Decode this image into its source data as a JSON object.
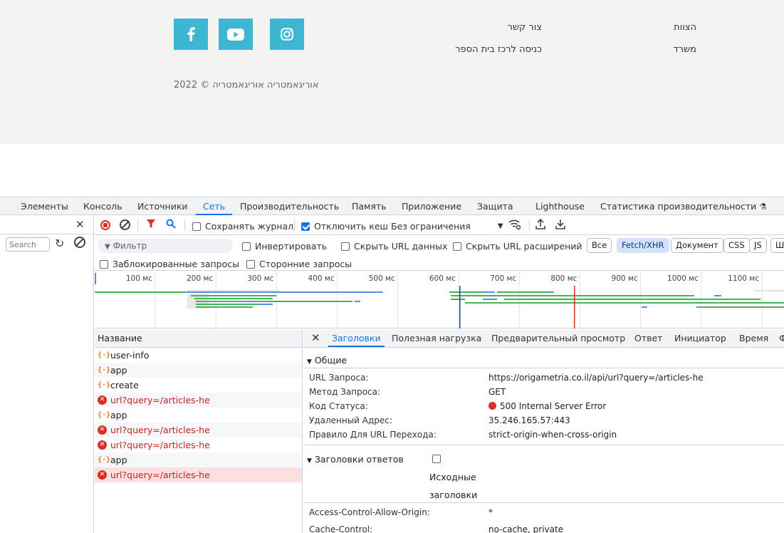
{
  "footer": {
    "links": [
      {
        "label": "הצוות"
      },
      {
        "label": "משרד"
      },
      {
        "label": "צור קשר"
      },
      {
        "label": "כניסה לרכז בית הספר"
      }
    ],
    "social": [
      "facebook-icon",
      "youtube-icon",
      "instagram-icon"
    ],
    "copyright": "2022 © אוריגאמטריה אוריגאמטריה",
    "accent_color": "#3cb6d3"
  },
  "devtools": {
    "tabs": [
      "Элементы",
      "Консоль",
      "Источники",
      "Сеть",
      "Производительность",
      "Память",
      "Приложение",
      "Защита",
      "Lighthouse",
      "Статистика производительности"
    ],
    "active_tab": "Сеть",
    "left": {
      "search_placeholder": "Search"
    },
    "toolbar": {
      "preserve_log": "Сохранять журнал",
      "disable_cache": "Отключить кеш",
      "throttling": "Без ограничения"
    },
    "filter": {
      "placeholder": "Фильтр",
      "invert": "Инвертировать",
      "hide_data_urls": "Скрыть URL данных",
      "hide_ext_urls": "Скрыть URL расширений",
      "chips": [
        "Все",
        "Fetch/XHR",
        "Документ",
        "CSS",
        "JS",
        "Шр"
      ],
      "active_chip": "Fetch/XHR",
      "blocked": "Заблокированные запросы",
      "third_party": "Сторонние запросы"
    },
    "timeline_ticks": [
      "100 мс",
      "200 мс",
      "300 мс",
      "400 мс",
      "500 мс",
      "600 мс",
      "700 мс",
      "800 мс",
      "900 мс",
      "1000 мс",
      "1100 мс"
    ],
    "requests": {
      "header": "Название",
      "rows": [
        {
          "name": "user-info",
          "error": false
        },
        {
          "name": "app",
          "error": false
        },
        {
          "name": "create",
          "error": false
        },
        {
          "name": "url?query=/articles-he",
          "error": true
        },
        {
          "name": "app",
          "error": false
        },
        {
          "name": "url?query=/articles-he",
          "error": true
        },
        {
          "name": "url?query=/articles-he",
          "error": true
        },
        {
          "name": "app",
          "error": false
        },
        {
          "name": "url?query=/articles-he",
          "error": true
        }
      ]
    },
    "details": {
      "tabs": [
        "Заголовки",
        "Полезная нагрузка",
        "Предварительный просмотр",
        "Ответ",
        "Инициатор",
        "Время",
        "Ф"
      ],
      "active_tab": "Заголовки",
      "general_title": "Общие",
      "general": [
        {
          "key": "URL Запроса:",
          "value": "https://origametria.co.il/api/url?query=/articles-he"
        },
        {
          "key": "Метод Запроса:",
          "value": "GET"
        },
        {
          "key": "Код Статуса:",
          "value": "500 Internal Server Error"
        },
        {
          "key": "Удаленный Адрес:",
          "value": "35.246.165.57:443"
        },
        {
          "key": "Правило Для URL Перехода:",
          "value": "strict-origin-when-cross-origin"
        }
      ],
      "response_title": "Заголовки ответов",
      "raw_headers": "Исходные",
      "raw_headers_2": "заголовки",
      "response": [
        {
          "key": "Access-Control-Allow-Origin:",
          "value": "*"
        },
        {
          "key": "Cache-Control:",
          "value": "no-cache, private"
        }
      ]
    }
  }
}
